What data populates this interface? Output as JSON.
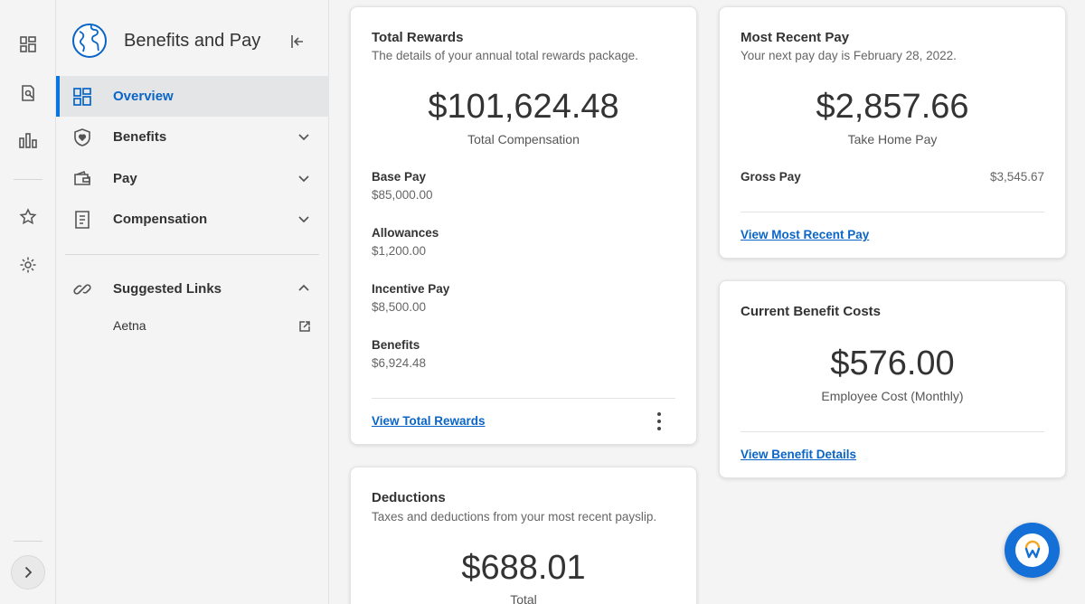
{
  "rail": {
    "icons": [
      "dashboard-icon",
      "report-icon",
      "chart-icon",
      "star-icon",
      "settings-icon",
      "chevron-right-icon"
    ]
  },
  "sidebar": {
    "title": "Benefits and Pay",
    "nav": [
      {
        "label": "Overview",
        "icon": "overview-icon",
        "active": true
      },
      {
        "label": "Benefits",
        "icon": "shield-heart-icon"
      },
      {
        "label": "Pay",
        "icon": "wallet-icon"
      },
      {
        "label": "Compensation",
        "icon": "document-icon"
      }
    ],
    "suggested": {
      "label": "Suggested Links",
      "links": [
        {
          "label": "Aetna"
        }
      ]
    }
  },
  "total_rewards": {
    "title": "Total Rewards",
    "subtitle": "The details of your annual total rewards package.",
    "amount": "$101,624.48",
    "amount_label": "Total Compensation",
    "items": [
      {
        "label": "Base Pay",
        "value": "$85,000.00"
      },
      {
        "label": "Allowances",
        "value": "$1,200.00"
      },
      {
        "label": "Incentive Pay",
        "value": "$8,500.00"
      },
      {
        "label": "Benefits",
        "value": "$6,924.48"
      }
    ],
    "link": "View Total Rewards"
  },
  "deductions": {
    "title": "Deductions",
    "subtitle": "Taxes and deductions from your most recent payslip.",
    "amount": "$688.01",
    "amount_label": "Total"
  },
  "recent_pay": {
    "title": "Most Recent Pay",
    "subtitle": "Your next pay day is February 28, 2022.",
    "amount": "$2,857.66",
    "amount_label": "Take Home Pay",
    "gross_label": "Gross Pay",
    "gross_value": "$3,545.67",
    "link": "View Most Recent Pay"
  },
  "benefit_costs": {
    "title": "Current Benefit Costs",
    "amount": "$576.00",
    "amount_label": "Employee Cost (Monthly)",
    "link": "View Benefit Details"
  },
  "colors": {
    "accent": "#0875e1",
    "link": "#0a65c7",
    "assistant": "#1470d6"
  }
}
